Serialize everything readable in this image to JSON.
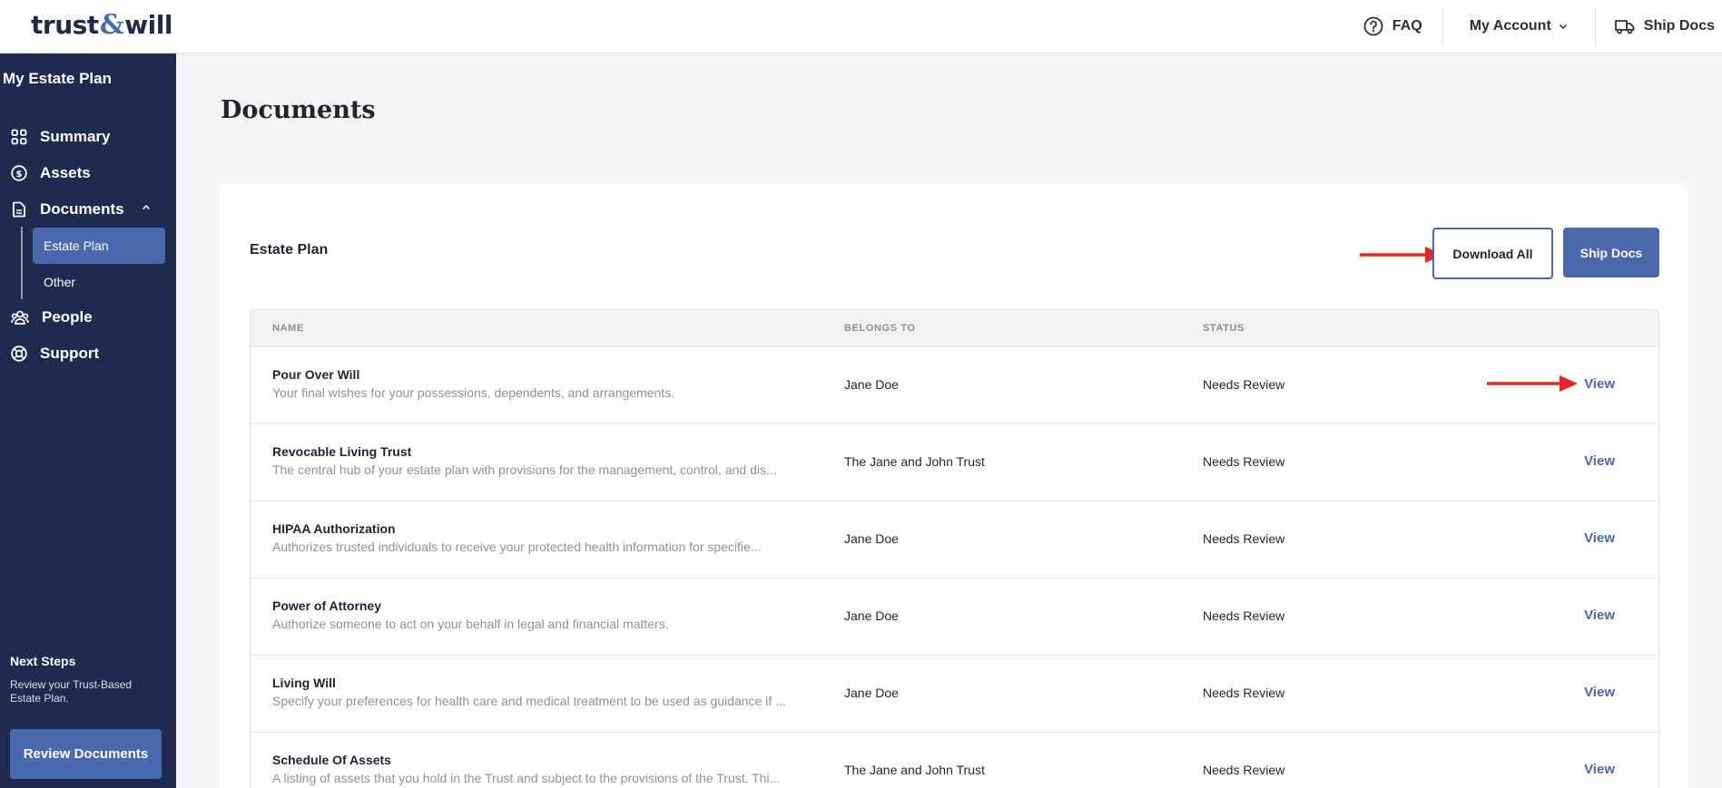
{
  "header": {
    "logo_left": "trust",
    "logo_amp": "&",
    "logo_right": "will",
    "faq_label": "FAQ",
    "account_label": "My Account",
    "ship_label": "Ship Docs"
  },
  "sidebar": {
    "title": "My Estate Plan",
    "items": [
      {
        "label": "Summary",
        "icon": "grid-icon"
      },
      {
        "label": "Assets",
        "icon": "dollar-icon"
      },
      {
        "label": "Documents",
        "icon": "document-icon"
      },
      {
        "label": "People",
        "icon": "people-icon"
      },
      {
        "label": "Support",
        "icon": "lifebuoy-icon"
      }
    ],
    "sub_items": [
      {
        "label": "Estate Plan",
        "active": true
      },
      {
        "label": "Other",
        "active": false
      }
    ],
    "next_steps_title": "Next Steps",
    "next_steps_text": "Review your Trust-Based Estate Plan.",
    "review_button": "Review Documents"
  },
  "main": {
    "page_title": "Documents",
    "section_title": "Estate Plan",
    "download_all": "Download All",
    "ship_docs": "Ship Docs",
    "columns": [
      "NAME",
      "BELONGS TO",
      "STATUS"
    ],
    "rows": [
      {
        "title": "Pour Over Will",
        "desc": "Your final wishes for your possessions, dependents, and arrangements.",
        "owner": "Jane Doe",
        "status": "Needs Review",
        "action": "View"
      },
      {
        "title": "Revocable Living Trust",
        "desc": "The central hub of your estate plan with provisions for the management, control, and dis...",
        "owner": "The Jane and John Trust",
        "status": "Needs Review",
        "action": "View"
      },
      {
        "title": "HIPAA Authorization",
        "desc": "Authorizes trusted individuals to receive your protected health information for specifie...",
        "owner": "Jane Doe",
        "status": "Needs Review",
        "action": "View"
      },
      {
        "title": "Power of Attorney",
        "desc": "Authorize someone to act on your behalf in legal and financial matters.",
        "owner": "Jane Doe",
        "status": "Needs Review",
        "action": "View"
      },
      {
        "title": "Living Will",
        "desc": "Specify your preferences for health care and medical treatment to be used as guidance if ...",
        "owner": "Jane Doe",
        "status": "Needs Review",
        "action": "View"
      },
      {
        "title": "Schedule Of Assets",
        "desc": "A listing of assets that you hold in the Trust and subject to the provisions of the Trust. Thi...",
        "owner": "The Jane and John Trust",
        "status": "Needs Review",
        "action": "View"
      }
    ]
  },
  "colors": {
    "sidebar_bg": "#1e2b4e",
    "accent": "#4a68ad",
    "annotation_arrow": "#e8251f"
  }
}
